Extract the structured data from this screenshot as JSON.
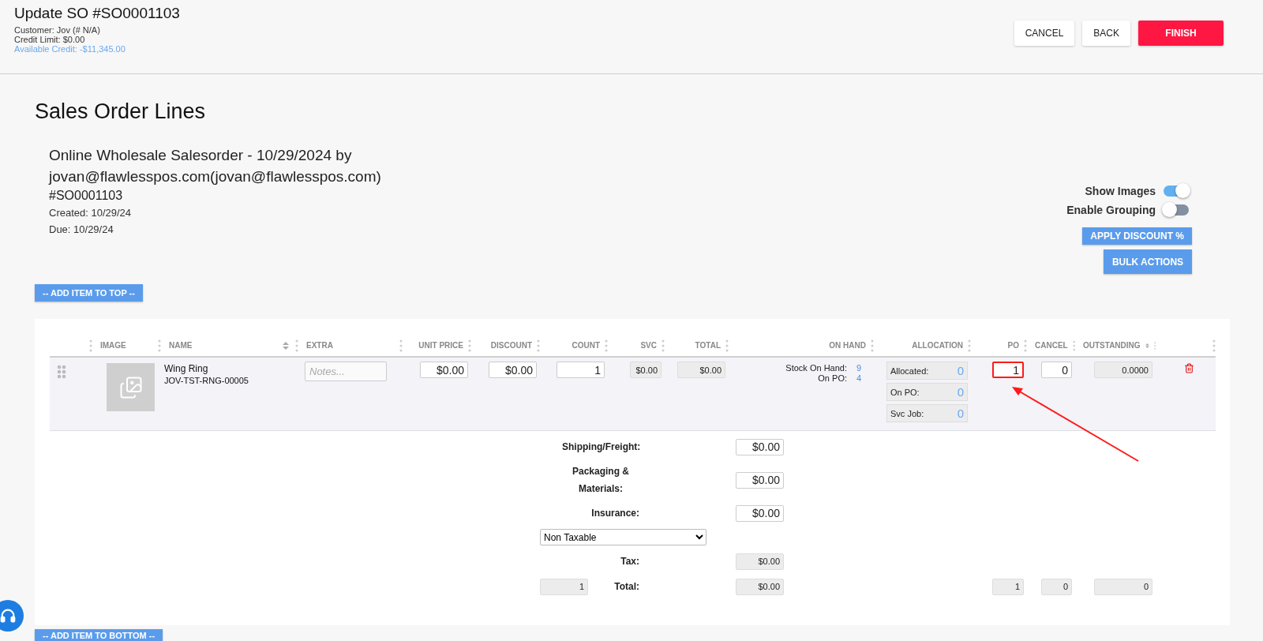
{
  "header": {
    "title": "Update SO #SO0001103",
    "customer": "Customer: Jov (# N/A)",
    "credit_limit": "Credit Limit: $0.00",
    "available_credit": "Available Credit: -$11,345.00"
  },
  "header_buttons": [
    {
      "label": "CANCEL",
      "kind": "plain"
    },
    {
      "label": "BACK",
      "kind": "plain"
    },
    {
      "label": "FINISH",
      "kind": "primary"
    }
  ],
  "section_title": "Sales Order Lines",
  "order": {
    "heading": "Online Wholesale Salesorder - 10/29/2024 by jovan@flawlesspos.com(jovan@flawlesspos.com)",
    "number": "#SO0001103",
    "created": "Created: 10/29/24",
    "due": "Due: 10/29/24"
  },
  "toggles": [
    {
      "label": "Show Images",
      "on": true
    },
    {
      "label": "Enable Grouping",
      "on": false
    }
  ],
  "action_buttons": [
    "APPLY DISCOUNT %",
    "BULK ACTIONS"
  ],
  "add_top_button": "-- ADD ITEM TO TOP --",
  "columns": [
    {
      "label": "IMAGE",
      "kind": "text",
      "sortable": false
    },
    {
      "label": "NAME",
      "kind": "text",
      "sortable": true
    },
    {
      "label": "EXTRA",
      "kind": "text",
      "sortable": false
    },
    {
      "label": "UNIT PRICE",
      "kind": "number",
      "sortable": false
    },
    {
      "label": "DISCOUNT",
      "kind": "number",
      "sortable": false
    },
    {
      "label": "COUNT",
      "kind": "number",
      "sortable": false
    },
    {
      "label": "SVC",
      "kind": "number",
      "sortable": false
    },
    {
      "label": "TOTAL",
      "kind": "number",
      "sortable": false
    },
    {
      "label": "ON HAND",
      "kind": "number",
      "sortable": false
    },
    {
      "label": "ALLOCATION",
      "kind": "number",
      "sortable": false
    },
    {
      "label": "PO",
      "kind": "number",
      "sortable": false
    },
    {
      "label": "CANCEL",
      "kind": "number",
      "sortable": false
    },
    {
      "label": "OUTSTANDING",
      "kind": "number",
      "sortable": true
    }
  ],
  "rows": [
    {
      "name": "Wing Ring",
      "sku": "JOV-TST-RNG-00005",
      "notes_placeholder": "Notes...",
      "unit_price": "$0.00",
      "discount": "$0.00",
      "count": "1",
      "svc": "$0.00",
      "total": "$0.00",
      "on_hand": [
        {
          "label": "Stock On Hand:",
          "value": "9"
        },
        {
          "label": "On PO:",
          "value": "4"
        }
      ],
      "allocation": [
        {
          "label": "Allocated:",
          "value": "0"
        },
        {
          "label": "On PO:",
          "value": "0"
        },
        {
          "label": "Svc Job:",
          "value": "0"
        }
      ],
      "po": "1",
      "po_highlighted": true,
      "cancel": "0",
      "outstanding": "0.0000"
    }
  ],
  "charges": [
    {
      "label": "Shipping/Freight:",
      "value": "$0.00"
    },
    {
      "label": "Packaging & Materials:",
      "value": "$0.00"
    },
    {
      "label": "Insurance:",
      "value": "$0.00"
    }
  ],
  "tax_option": "Non Taxable",
  "tax": {
    "label": "Tax:",
    "value": "$0.00"
  },
  "totals": {
    "count": "1",
    "label": "Total:",
    "total": "$0.00",
    "po": "1",
    "cancel": "0",
    "outstanding": "0"
  },
  "add_bottom_button": "-- ADD ITEM TO BOTTOM --"
}
